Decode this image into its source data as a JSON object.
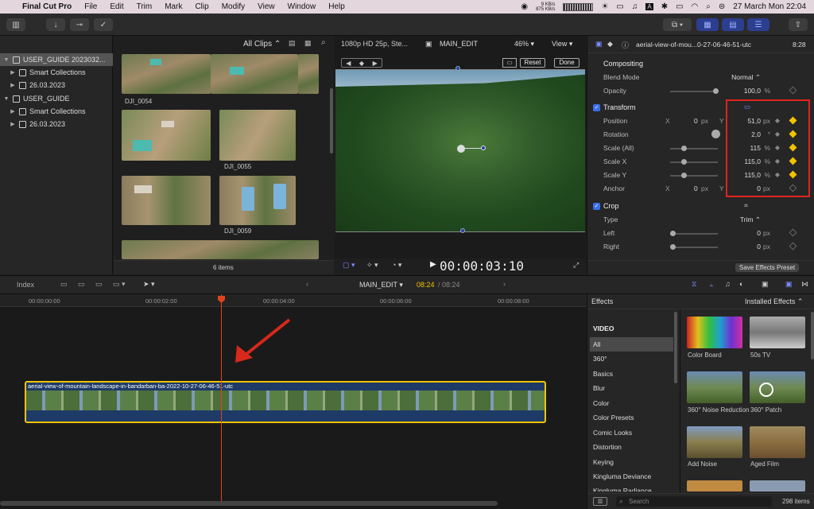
{
  "menubar": {
    "app": "Final Cut Pro",
    "items": [
      "File",
      "Edit",
      "Trim",
      "Mark",
      "Clip",
      "Modify",
      "View",
      "Window",
      "Help"
    ],
    "net_up": "9 KB/s",
    "net_down": "875 KB/s",
    "clock": "27 March Mon  22:04"
  },
  "libraries": [
    {
      "label": "USER_GUIDE 2023032...",
      "indent": 0,
      "selected": true,
      "type": "library"
    },
    {
      "label": "Smart Collections",
      "indent": 1,
      "selected": false,
      "type": "folder"
    },
    {
      "label": "26.03.2023",
      "indent": 1,
      "selected": false,
      "type": "event"
    },
    {
      "label": "USER_GUIDE",
      "indent": 0,
      "selected": false,
      "type": "library"
    },
    {
      "label": "Smart Collections",
      "indent": 1,
      "selected": false,
      "type": "folder"
    },
    {
      "label": "26.03.2023",
      "indent": 1,
      "selected": false,
      "type": "event"
    }
  ],
  "browser": {
    "filter": "All Clips",
    "clips": [
      "DJI_0054",
      "DJI_0055",
      "DJI_0059"
    ],
    "count": "6 items"
  },
  "viewer": {
    "format": "1080p HD 25p, Ste...",
    "project": "MAIN_EDIT",
    "zoom": "46%",
    "view_menu": "View",
    "reset": "Reset",
    "done": "Done",
    "timecode": "00:00:03:10"
  },
  "inspector": {
    "clip_name": "aerial-view-of-mou...0-27-06-46-51-utc",
    "duration": "8:28",
    "compositing": "Compositing",
    "blend_mode_label": "Blend Mode",
    "blend_mode": "Normal",
    "opacity_label": "Opacity",
    "opacity": "100,0",
    "opacity_unit": "%",
    "transform": "Transform",
    "position_label": "Position",
    "position_x": "0",
    "position_y": "51,0",
    "rotation_label": "Rotation",
    "rotation": "2,0",
    "rotation_unit": "°",
    "scale_all_label": "Scale (All)",
    "scale_all": "115",
    "scale_x_label": "Scale X",
    "scale_x": "115,0",
    "scale_y_label": "Scale Y",
    "scale_y": "115,0",
    "anchor_label": "Anchor",
    "anchor_x": "0",
    "anchor_y": "0",
    "crop": "Crop",
    "type_label": "Type",
    "crop_type": "Trim",
    "left_label": "Left",
    "left": "0",
    "right_label": "Right",
    "right": "0",
    "px": "px",
    "x": "X",
    "y": "Y",
    "save_preset": "Save Effects Preset"
  },
  "timeline": {
    "index": "Index",
    "project": "MAIN_EDIT",
    "time_current": "08:24",
    "time_total": "/ 08:24",
    "ruler": [
      "00:00:00:00",
      "00:00:02:00",
      "00:00:04:00",
      "00:00:06:00",
      "00:00:08:00"
    ],
    "clip_name": "aerial-view-of-mountain-landscape-in-bandarban-ba-2022-10-27-06-46-51-utc"
  },
  "effects": {
    "title": "Effects",
    "installed": "Installed Effects",
    "section": "VIDEO",
    "categories": [
      "All",
      "360°",
      "Basics",
      "Blur",
      "Color",
      "Color Presets",
      "Comic Looks",
      "Distortion",
      "Keying",
      "Kingluma Deviance",
      "Kingluma Radiance"
    ],
    "items": [
      "Color Board",
      "50s TV",
      "360° Noise Reduction",
      "360° Patch",
      "Add Noise",
      "Aged Film"
    ],
    "search_placeholder": "Search",
    "count": "298 items"
  },
  "colors": {
    "accent": "#3a6ee8",
    "keyframe": "#f2c200",
    "clip_border": "#f4c400",
    "playhead": "#e0431c",
    "highlight_box": "#e0231c"
  }
}
